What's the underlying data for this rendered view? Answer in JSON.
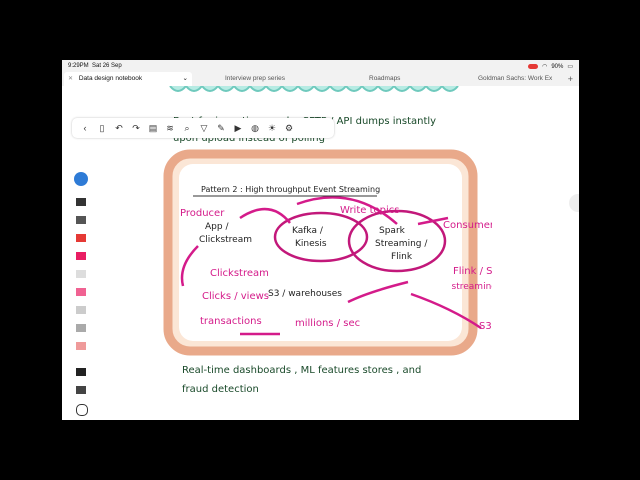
{
  "status": {
    "time": "9:29PM",
    "date": "Sat 26 Sep",
    "wifi": "wifi",
    "battery": "90%"
  },
  "tabs": [
    {
      "label": "Data design notebook",
      "active": true
    },
    {
      "label": "Interview prep series",
      "active": false
    },
    {
      "label": "Roadmaps",
      "active": false
    },
    {
      "label": "Goldman Sachs: Work Ex",
      "active": false
    }
  ],
  "notes": {
    "intro_line1": "Best for ingesting vendor SFTP / API dumps instantly",
    "intro_line2": "upon upload instead of polling",
    "pattern_title": "Pattern 2 : High throughput Event Streaming",
    "producer": "Producer",
    "app_clickstream_1": "App /",
    "app_clickstream_2": "Clickstream",
    "kafka_1": "Kafka /",
    "kafka_2": "Kinesis",
    "write_topics": "Write topics",
    "spark_1": "Spark",
    "spark_2": "Streaming /",
    "spark_3": "Flink",
    "consumer": "Consumer",
    "clickstream": "Clickstream",
    "clicks_views": "Clicks / views",
    "s3_warehouses": "S3 / warehouses",
    "flink_spark_1": "Flink / Spark",
    "flink_spark_2": "streaming",
    "s3": "S3",
    "transactions": "transactions",
    "millions": "millions / sec",
    "footer_line1": "Real-time dashboards , ML features stores , and",
    "footer_line2": "fraud detection"
  }
}
